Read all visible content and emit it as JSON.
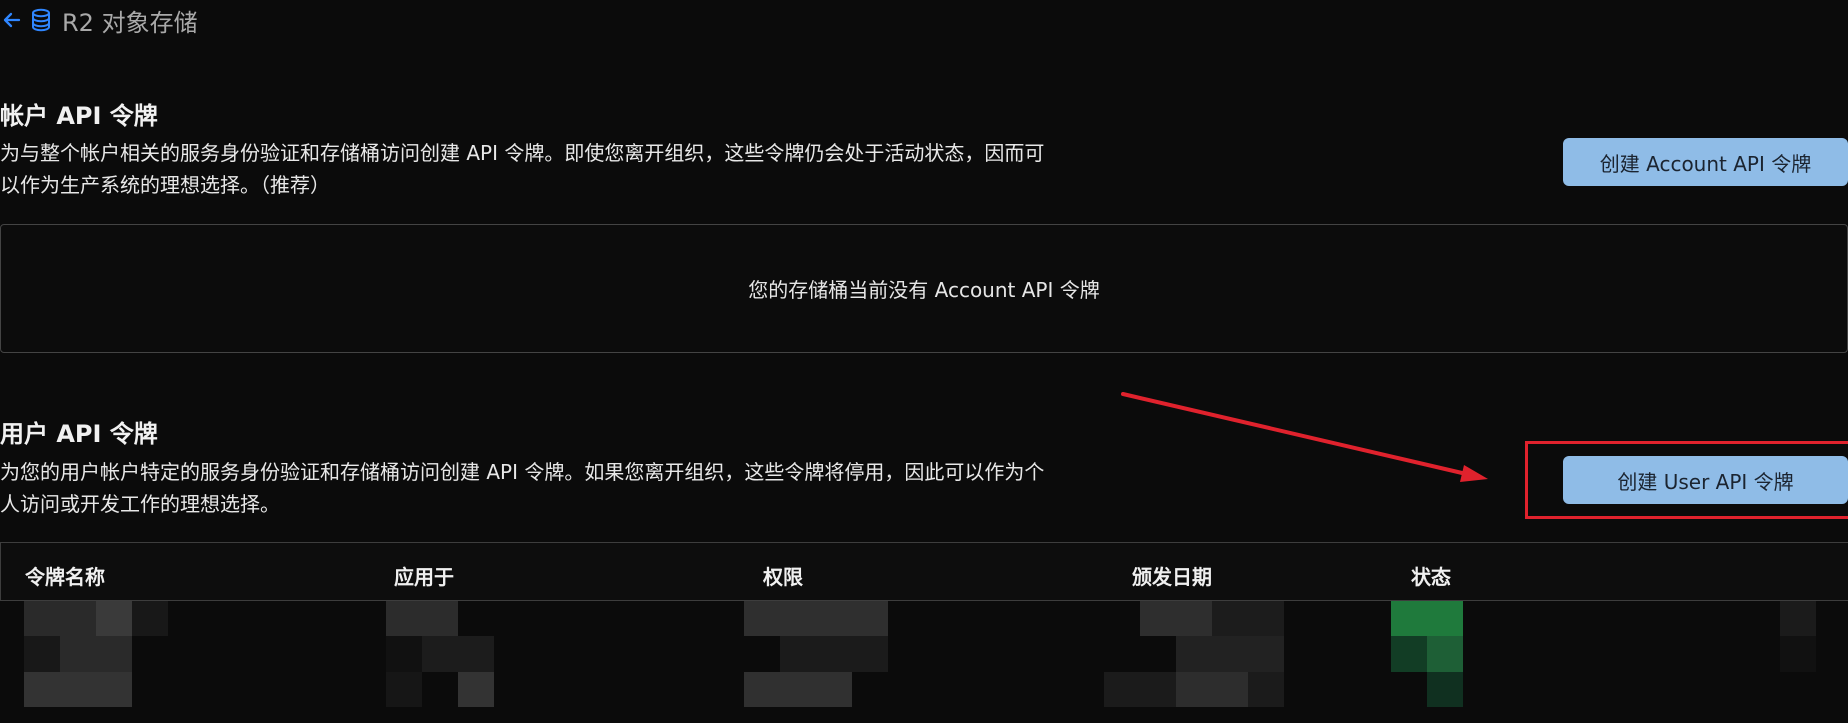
{
  "breadcrumb": {
    "back_icon": "back-arrow-icon",
    "storage_icon": "database-icon",
    "label": "R2 对象存储"
  },
  "account_tokens": {
    "title": "帐户 API 令牌",
    "description_line1": "为与整个帐户相关的服务身份验证和存储桶访问创建 API 令牌。即使您离开组织，这些令牌仍会处于活动状态，因而可",
    "description_line2": "以作为生产系统的理想选择。（推荐）",
    "button_label": "创建 Account API 令牌",
    "empty_message": "您的存储桶当前没有 Account API 令牌"
  },
  "user_tokens": {
    "title": "用户 API 令牌",
    "description_line1": "为您的用户帐户特定的服务身份验证和存储桶访问创建 API 令牌。如果您离开组织，这些令牌将停用，因此可以作为个",
    "description_line2": "人访问或开发工作的理想选择。",
    "button_label": "创建 User API 令牌"
  },
  "table": {
    "headers": {
      "name": "令牌名称",
      "applies_to": "应用于",
      "permissions": "权限",
      "issued_date": "颁发日期",
      "status": "状态"
    }
  },
  "colors": {
    "background": "#0b0b0b",
    "button_blue": "#8fbce7",
    "highlight_red": "#e0222d",
    "border": "#444444",
    "status_green": "#1f7a3c"
  }
}
